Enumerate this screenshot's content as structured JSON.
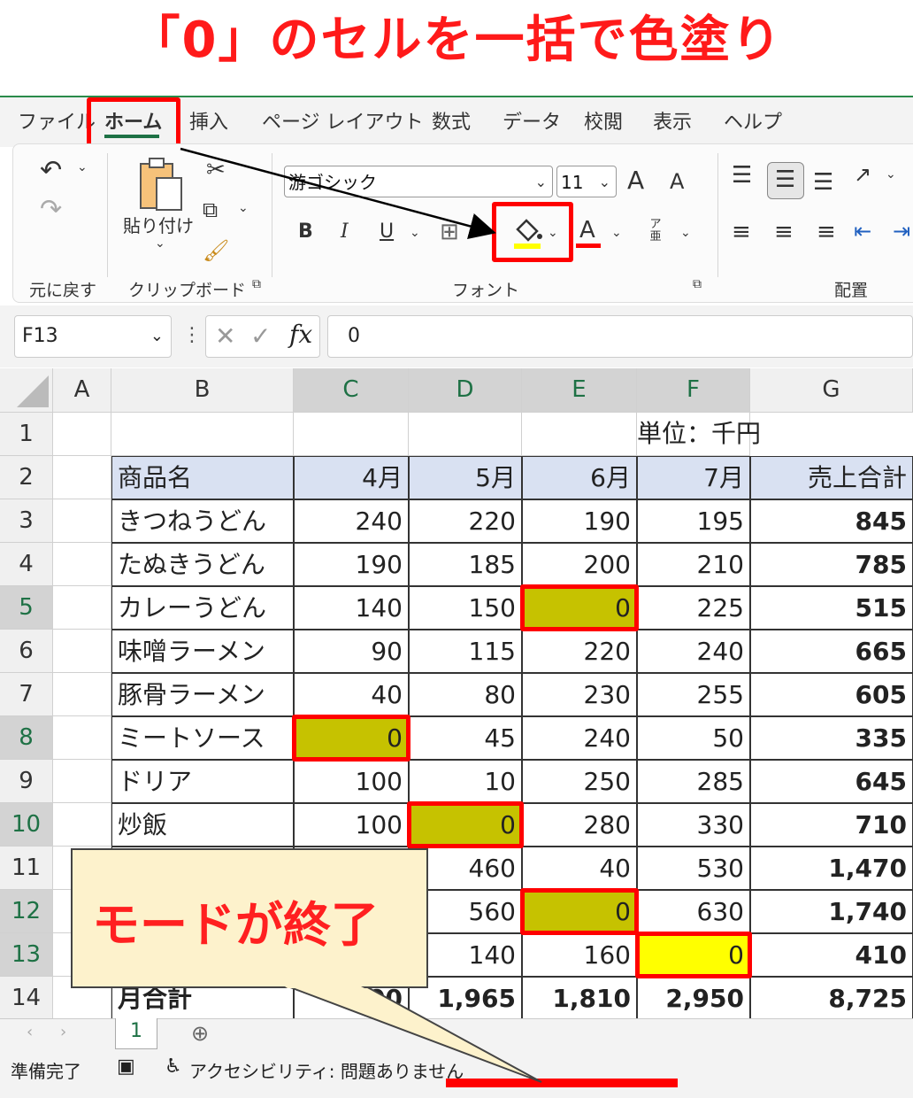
{
  "title": "「0」のセルを一括で色塗り",
  "menu": [
    "ファイル",
    "ホーム",
    "挿入",
    "ページ レイアウト",
    "数式",
    "データ",
    "校閲",
    "表示",
    "ヘルプ"
  ],
  "ribbon": {
    "paste_label": "貼り付け",
    "font_name": "游ゴシック",
    "font_size": "11",
    "groups": {
      "undo": "元に戻す",
      "clipboard": "クリップボード",
      "font": "フォント",
      "align": "配置"
    },
    "bold": "B",
    "italic": "I",
    "underline": "U",
    "font_color_letter": "A",
    "grow": "A",
    "shrink": "A",
    "phonetic": "ア亜"
  },
  "namebox": "F13",
  "formula_value": "0",
  "columns": [
    "A",
    "B",
    "C",
    "D",
    "E",
    "F",
    "G"
  ],
  "unit_label": "単位：千円",
  "header_row": [
    "商品名",
    "4月",
    "5月",
    "6月",
    "7月",
    "売上合計"
  ],
  "rows": [
    {
      "n": "3",
      "name": "きつねうどん",
      "c": "240",
      "d": "220",
      "e": "190",
      "f": "195",
      "g": "845"
    },
    {
      "n": "4",
      "name": "たぬきうどん",
      "c": "190",
      "d": "185",
      "e": "200",
      "f": "210",
      "g": "785"
    },
    {
      "n": "5",
      "name": "カレーうどん",
      "c": "140",
      "d": "150",
      "e": "0",
      "f": "225",
      "g": "515"
    },
    {
      "n": "6",
      "name": "味噌ラーメン",
      "c": "90",
      "d": "115",
      "e": "220",
      "f": "240",
      "g": "665"
    },
    {
      "n": "7",
      "name": "豚骨ラーメン",
      "c": "40",
      "d": "80",
      "e": "230",
      "f": "255",
      "g": "605"
    },
    {
      "n": "8",
      "name": "ミートソース",
      "c": "0",
      "d": "45",
      "e": "240",
      "f": "50",
      "g": "335"
    },
    {
      "n": "9",
      "name": "ドリア",
      "c": "100",
      "d": "10",
      "e": "250",
      "f": "285",
      "g": "645"
    },
    {
      "n": "10",
      "name": "炒飯",
      "c": "100",
      "d": "0",
      "e": "280",
      "f": "330",
      "g": "710"
    },
    {
      "n": "11",
      "name": "",
      "c": "",
      "d": "460",
      "e": "40",
      "f": "530",
      "g": "1,470"
    },
    {
      "n": "12",
      "name": "",
      "c": "",
      "d": "560",
      "e": "0",
      "f": "630",
      "g": "1,740"
    },
    {
      "n": "13",
      "name": "",
      "c": "",
      "d": "140",
      "e": "160",
      "f": "0",
      "g": "410"
    }
  ],
  "total_row": {
    "n": "14",
    "name": "月合計",
    "c": "00",
    "d": "1,965",
    "e": "1,810",
    "f": "2,950",
    "g": "8,725"
  },
  "sheet_tab": "1",
  "status": {
    "ready": "準備完了",
    "accessibility": "アクセシビリティ: 問題ありません"
  },
  "callout": "モードが終了",
  "colors": {
    "accent": "#ff0000",
    "highlight_olive": "#c6c200",
    "highlight_yellow": "#ffff00",
    "excel_green": "#1e7145"
  }
}
